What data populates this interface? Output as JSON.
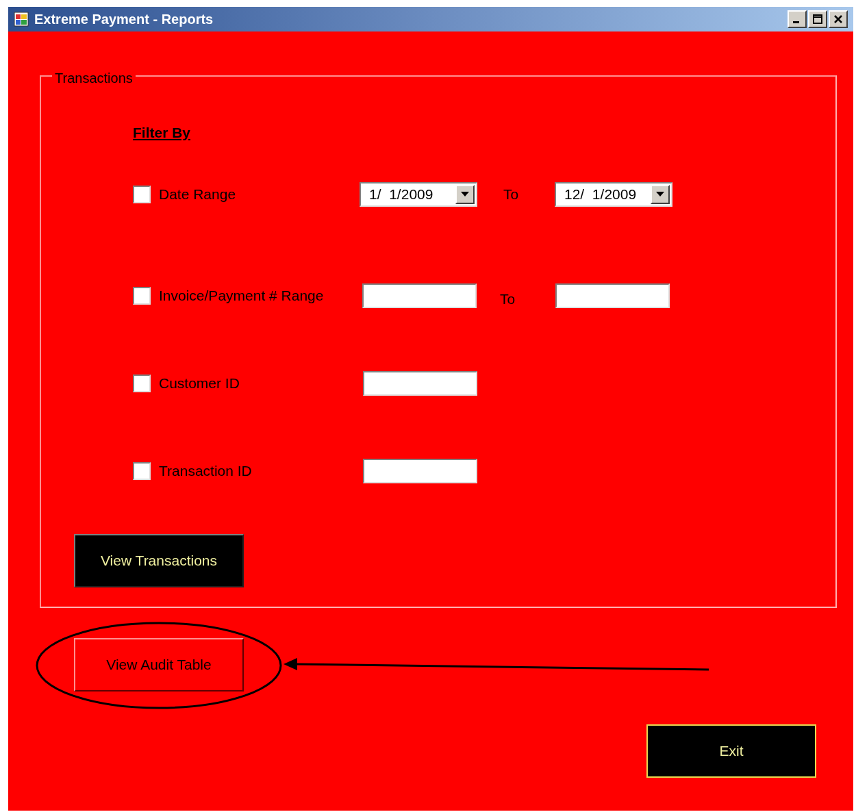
{
  "window": {
    "title": "Extreme Payment - Reports"
  },
  "group": {
    "title": "Transactions",
    "heading": "Filter By",
    "filters": [
      {
        "kind": "date",
        "label": "Date Range",
        "checked": false,
        "from": "1/  1/2009",
        "separator": "To",
        "to": "12/  1/2009"
      },
      {
        "kind": "range",
        "label": "Invoice/Payment # Range",
        "checked": false,
        "separator": "To"
      },
      {
        "kind": "single",
        "label": "Customer ID",
        "checked": false
      },
      {
        "kind": "single",
        "label": "Transaction ID",
        "checked": false
      }
    ],
    "button": "View Transactions"
  },
  "audit_button": {
    "label": "View Audit Table",
    "highlighted": true
  },
  "exit_button": "Exit"
}
